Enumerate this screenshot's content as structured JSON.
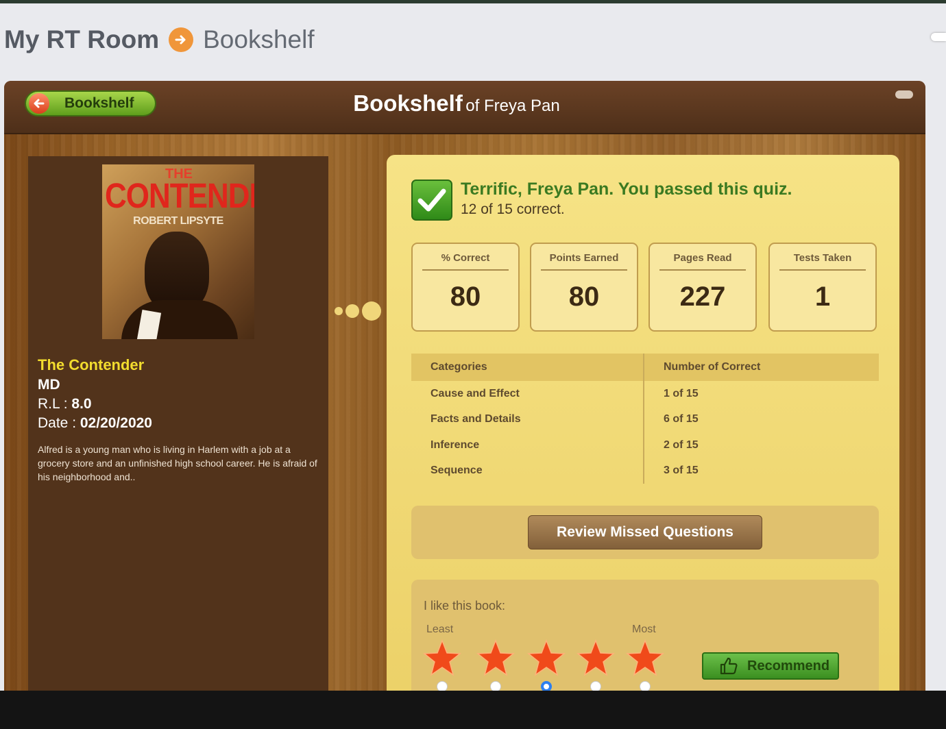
{
  "breadcrumb": {
    "home": "My RT Room",
    "current": "Bookshelf"
  },
  "header": {
    "back_label": "Bookshelf",
    "title_main": "Bookshelf",
    "title_sub": "of Freya Pan"
  },
  "book": {
    "cover_the": "THE",
    "cover_title": "CONTENDER",
    "cover_author": "ROBERT LIPSYTE",
    "title": "The Contender",
    "level": "MD",
    "rl_label": "R.L : ",
    "rl_value": "8.0",
    "date_label": "Date : ",
    "date_value": "02/20/2020",
    "description": "Alfred is a young man who is living in Harlem with a job at a grocery store and an unfinished high school career. He is afraid of his neighborhood and.."
  },
  "result": {
    "message": "Terrific, Freya Pan. You passed this quiz.",
    "score": "12 of 15 correct."
  },
  "stats": [
    {
      "label": "% Correct",
      "value": "80"
    },
    {
      "label": "Points Earned",
      "value": "80"
    },
    {
      "label": "Pages Read",
      "value": "227"
    },
    {
      "label": "Tests Taken",
      "value": "1"
    }
  ],
  "categories": {
    "header": [
      "Categories",
      "Number of Correct"
    ],
    "rows": [
      {
        "name": "Cause and Effect",
        "correct": "1 of 15"
      },
      {
        "name": "Facts and Details",
        "correct": "6 of 15"
      },
      {
        "name": "Inference",
        "correct": "2 of 15"
      },
      {
        "name": "Sequence",
        "correct": "3 of 15"
      }
    ]
  },
  "review_label": "Review Missed Questions",
  "rating": {
    "question": "I like this book:",
    "least": "Least",
    "most": "Most",
    "selected": 3,
    "max": 5,
    "recommend_label": "Recommend"
  },
  "colors": {
    "accent_green": "#3b7a21",
    "panel_brown": "#52331b",
    "title_yellow": "#f2dc2e",
    "star_orange": "#f04a1a",
    "selected_radio": "#2d7ff0"
  }
}
